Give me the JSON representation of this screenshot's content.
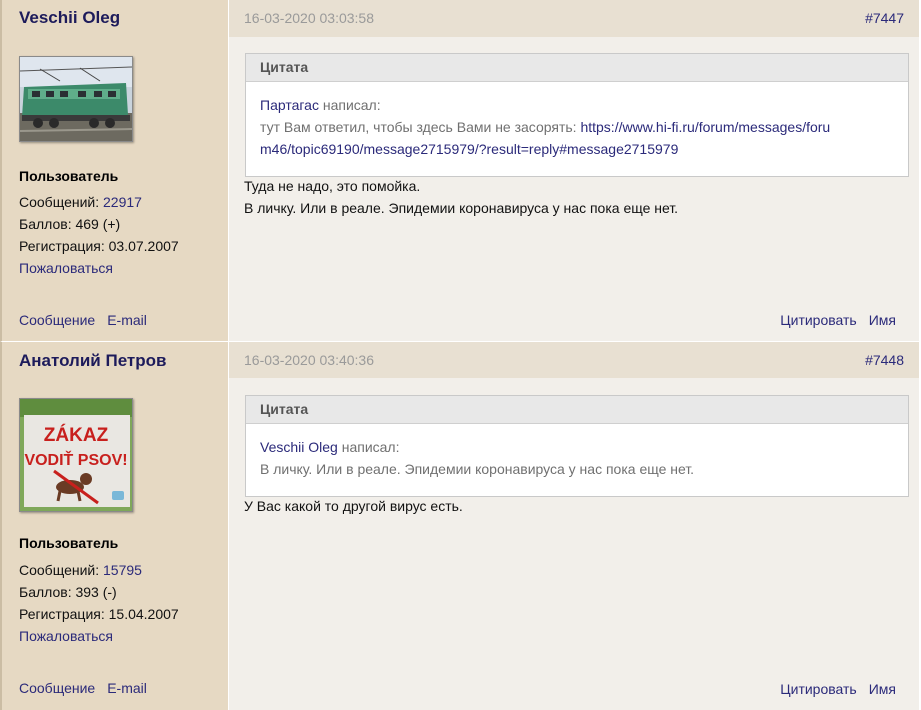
{
  "posts": [
    {
      "author": "Veschii Oleg",
      "role": "Пользователь",
      "messages_label": "Сообщений: ",
      "messages_count": "22917",
      "points": "Баллов: 469 (+)",
      "registration": "Регистрация: 03.07.2007",
      "report": "Пожаловаться",
      "pm": "Сообщение",
      "email": "E-mail",
      "date": "16-03-2020 03:03:58",
      "number": "#7447",
      "quote_title": "Цитата",
      "quote_author": "Партагас",
      "quote_wrote": " написал:",
      "quote_text": "тут Вам ответил, чтобы здесь Вами не засорять: ",
      "quote_link_line1": "https://www.hi-fi.ru/forum/messages/foru",
      "quote_link_line2": "m46/topic69190/message2715979/?result=reply#message2715979",
      "text_line1": "Туда не надо, это помойка.",
      "text_line2": "В личку. Или в реале. Эпидемии коронавируса у нас пока еще нет.",
      "cite": "Цитировать",
      "name": "Имя"
    },
    {
      "author": "Анатолий Петров",
      "role": "Пользователь",
      "messages_label": "Сообщений: ",
      "messages_count": "15795",
      "points": "Баллов: 393 (-)",
      "registration": "Регистрация: 15.04.2007",
      "report": "Пожаловаться",
      "pm": "Сообщение",
      "email": "E-mail",
      "date": "16-03-2020 03:40:36",
      "number": "#7448",
      "quote_title": "Цитата",
      "quote_author": "Veschii Oleg",
      "quote_wrote": " написал:",
      "quote_text": "В личку. Или в реале. Эпидемии коронавируса у нас пока еще нет.",
      "text_line1": "У Вас какой то другой вирус есть.",
      "cite": "Цитировать",
      "name": "Имя",
      "avatar_sign_line1": "ZÁKAZ",
      "avatar_sign_line2": "VODIŤ PSOV!"
    }
  ]
}
